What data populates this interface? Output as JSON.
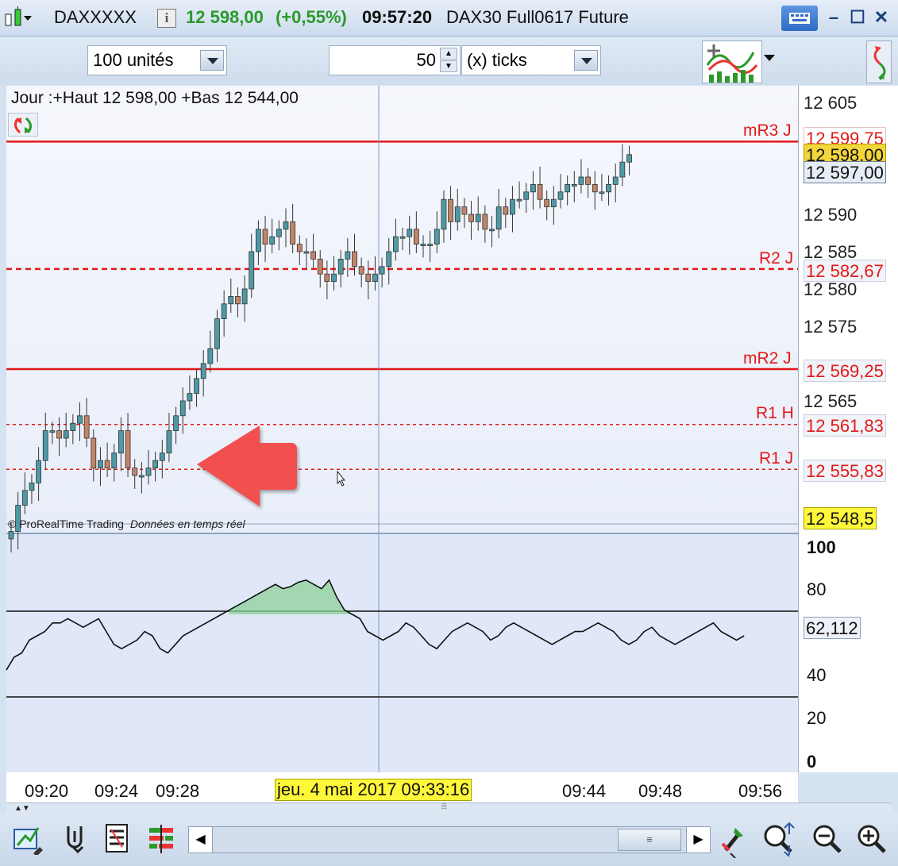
{
  "titlebar": {
    "symbol": "DAXXXXX",
    "price": "12 598,00",
    "change": "(+0,55%)",
    "time": "09:57:20",
    "instrument": "DAX30 Full0617 Future"
  },
  "toolbar": {
    "units": "100 unités",
    "ticks_value": "50",
    "ticks_unit": "(x) ticks"
  },
  "chart": {
    "header": "Jour :+Haut 12 598,00 +Bas 12 544,00",
    "watermark_brand": "© ProRealTime Trading",
    "watermark_note": "Données en temps réel",
    "price_ticks": [
      "12 605",
      "12 590",
      "12 585",
      "12 580",
      "12 575",
      "12 565"
    ],
    "levels": [
      {
        "name": "mR3 J",
        "value": "12 599,75"
      },
      {
        "name": "R2 J",
        "value": "12 582,67"
      },
      {
        "name": "mR2 J",
        "value": "12 569,25"
      },
      {
        "name": "R1 H",
        "value": "12 561,83"
      },
      {
        "name": "R1 J",
        "value": "12 555,83"
      }
    ],
    "last_price": "12 598,00",
    "crosshair_price": "12 597,00",
    "cursor_price": "12 548,5",
    "colors": {
      "up": "#4d9aa5",
      "down": "#c28468",
      "level": "#e31818",
      "arrow": "#f34a4a"
    }
  },
  "oscillator": {
    "ticks": [
      "100",
      "80",
      "40",
      "20",
      "0"
    ],
    "value": "62,112",
    "upper_level": 70,
    "lower_level": 30,
    "fill_color": "#8fd29a"
  },
  "time_axis": {
    "labels": [
      "09:20",
      "09:24",
      "09:28",
      "09:44",
      "09:48",
      "09:56"
    ],
    "crosshair_label": "jeu. 4 mai 2017 09:33:16"
  },
  "icons": [
    "candlestick-icon",
    "info-icon",
    "keyboard-icon",
    "minimize-icon",
    "maximize-icon",
    "close-icon",
    "indicators-icon",
    "arrows-icon",
    "draw-icon",
    "link-icon",
    "list-icon",
    "bars-icon",
    "scroll-left-icon",
    "scroll-right-icon",
    "tool-icon",
    "zoom-fit-icon",
    "zoom-out-icon",
    "zoom-in-icon"
  ]
}
